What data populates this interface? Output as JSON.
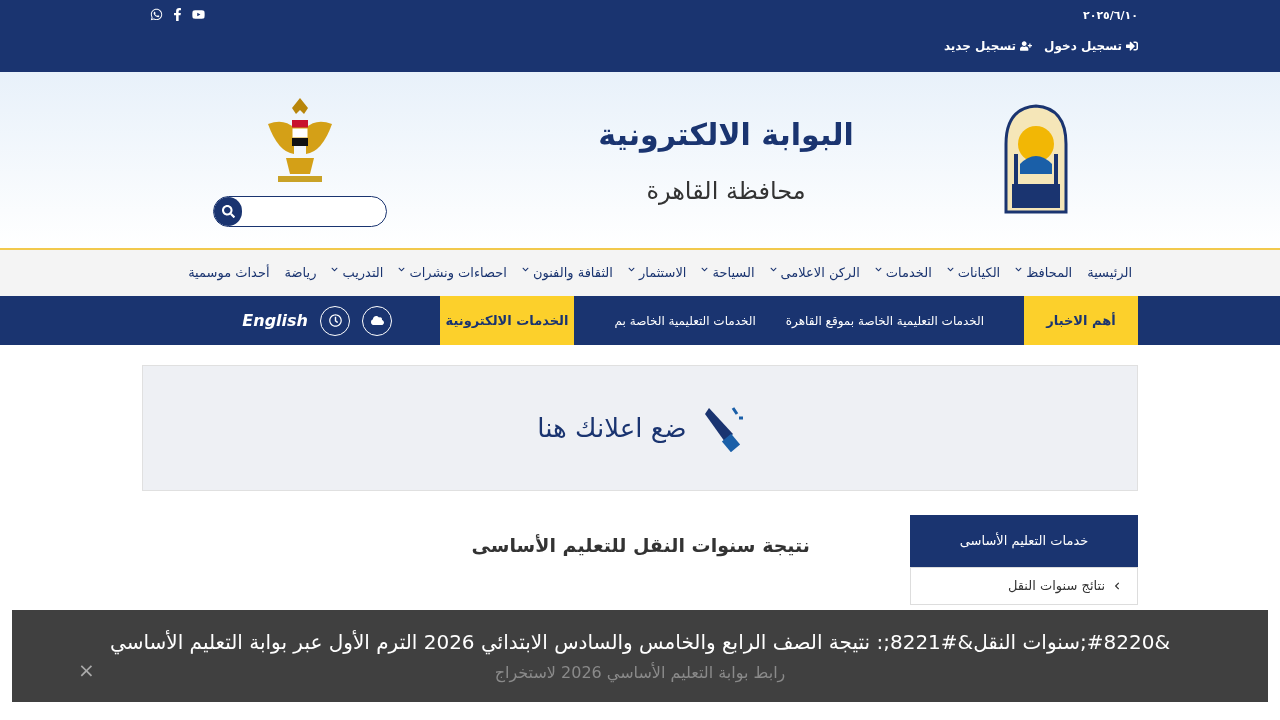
{
  "top_bar": {
    "date": "٢٠٢٥/٦/١٠",
    "links": [
      "تسجيل دخول",
      "تسجيل جديد"
    ]
  },
  "banner": {
    "title": "البوابة الالكترونية",
    "subtitle": "محافظة القاهرة"
  },
  "nav": [
    {
      "label": "الرئيسية",
      "dropdown": false
    },
    {
      "label": "المحافظ",
      "dropdown": true
    },
    {
      "label": "الكيانات",
      "dropdown": true
    },
    {
      "label": "الخدمات",
      "dropdown": true
    },
    {
      "label": "الركن الاعلامى",
      "dropdown": true
    },
    {
      "label": "السياحة",
      "dropdown": true
    },
    {
      "label": "الاستثمار",
      "dropdown": true
    },
    {
      "label": "الثقافة والفنون",
      "dropdown": true
    },
    {
      "label": "احصاءات ونشرات",
      "dropdown": true
    },
    {
      "label": "التدريب",
      "dropdown": true
    },
    {
      "label": "رياضة",
      "dropdown": false
    },
    {
      "label": "أحداث موسمية",
      "dropdown": false
    }
  ],
  "news_bar": {
    "label": "أهم الاخبار",
    "ticker": [
      "الخدمات التعليمية الخاصة بموقع القاهرة",
      "الخدمات التعليمية الخاصة بم"
    ],
    "eservices": "الخدمات الالكترونية",
    "language": "English"
  },
  "ad": {
    "text": "ضع اعلانك هنا"
  },
  "article": {
    "title": "نتيجة سنوات النقل للتعليم الأساسى"
  },
  "sidebar": {
    "title": "خدمات التعليم الأساسى",
    "items": [
      "نتائج سنوات النقل"
    ]
  },
  "caption": {
    "title": "&#8220;سنوات النقل&#8221;: نتيجة الصف الرابع والخامس والسادس الابتدائي 2026 الترم الأول عبر بوابة التعليم الأساسي",
    "subtitle": "رابط بوابة التعليم الأساسي 2026 لاستخراج",
    "close": "×"
  }
}
